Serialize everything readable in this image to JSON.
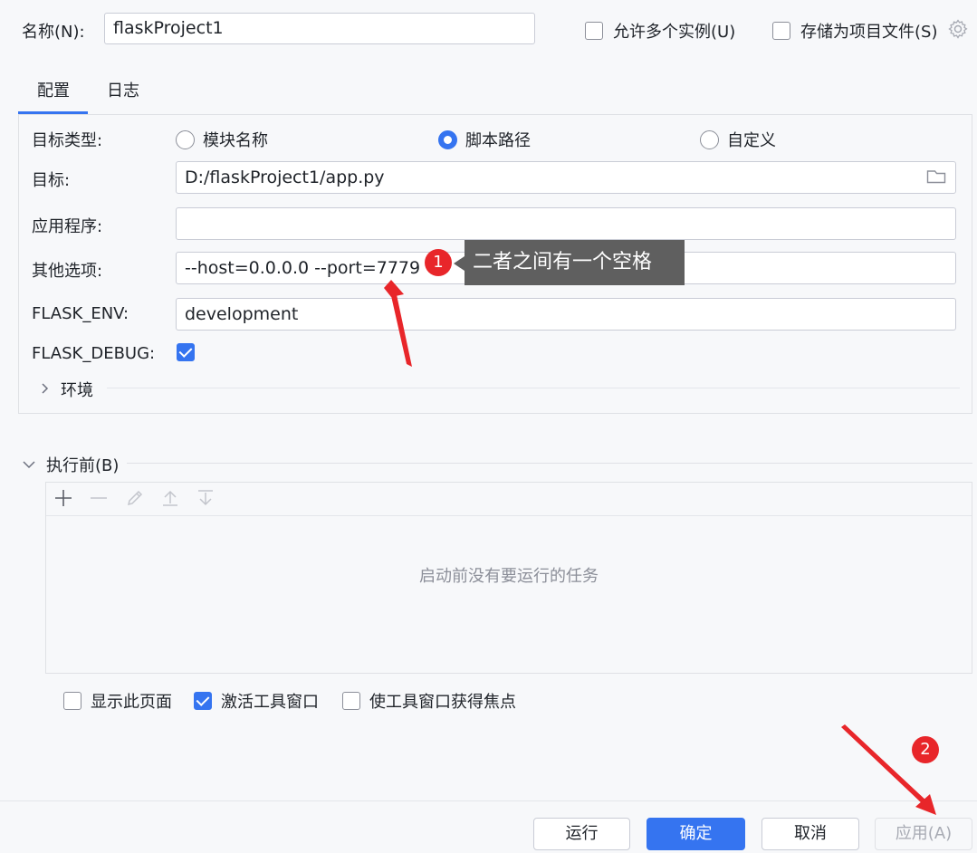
{
  "header": {
    "name_label": "名称(N):",
    "name_value": "flaskProject1",
    "allow_multiple_label": "允许多个实例(U)",
    "store_as_project_label": "存储为项目文件(S)"
  },
  "tabs": [
    {
      "label": "配置",
      "active": true
    },
    {
      "label": "日志",
      "active": false
    }
  ],
  "config": {
    "target_type_label": "目标类型:",
    "target_type_options": [
      {
        "label": "模块名称",
        "selected": false
      },
      {
        "label": "脚本路径",
        "selected": true
      },
      {
        "label": "自定义",
        "selected": false
      }
    ],
    "target_label": "目标:",
    "target_value": "D:/flaskProject1/app.py",
    "app_label": "应用程序:",
    "app_value": "",
    "options_label": "其他选项:",
    "options_value": "--host=0.0.0.0 --port=7779",
    "flask_env_label": "FLASK_ENV:",
    "flask_env_value": "development",
    "flask_debug_label": "FLASK_DEBUG:",
    "flask_debug_checked": true,
    "env_section_label": "环境"
  },
  "before_launch": {
    "title": "执行前(B)",
    "empty_text": "启动前没有要运行的任务",
    "toolbar_icons": [
      "plus-icon",
      "minus-icon",
      "edit-icon",
      "move-up-icon",
      "move-down-icon"
    ]
  },
  "options": [
    {
      "label": "显示此页面",
      "checked": false
    },
    {
      "label": "激活工具窗口",
      "checked": true
    },
    {
      "label": "使工具窗口获得焦点",
      "checked": false
    }
  ],
  "buttons": {
    "run": "运行",
    "ok": "确定",
    "cancel": "取消",
    "apply": "应用(A)"
  },
  "annotations": {
    "badge_1": "1",
    "tooltip_1": "二者之间有一个空格",
    "badge_2": "2"
  },
  "colors": {
    "accent": "#3574f0",
    "annotation_red": "#e8262a",
    "tooltip_bg": "#5f5f5f"
  }
}
